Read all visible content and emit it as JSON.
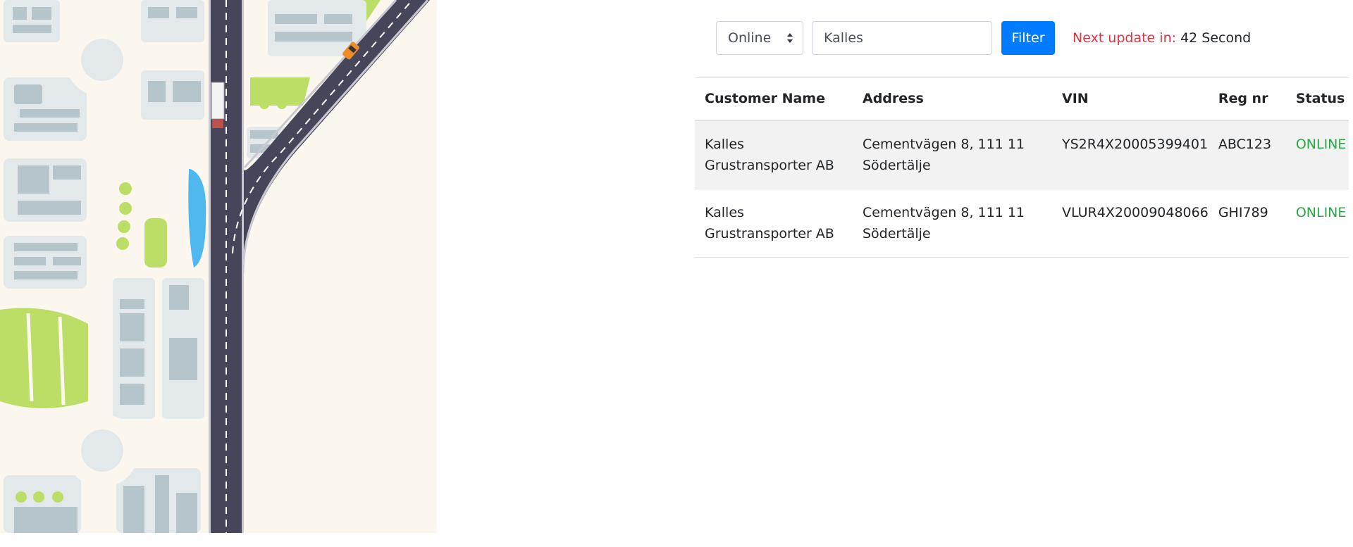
{
  "filters": {
    "status_selected": "Online",
    "search_value": "Kalles",
    "filter_button_label": "Filter",
    "next_update_label": "Next update in:",
    "next_update_value": "42 Second"
  },
  "table": {
    "headers": {
      "customer_name": "Customer Name",
      "address": "Address",
      "vin": "VIN",
      "reg_nr": "Reg nr",
      "status": "Status"
    },
    "rows": [
      {
        "customer_line1": "Kalles",
        "customer_line2": "Grustransporter AB",
        "address_line1": "Cementvägen 8, 111 11",
        "address_line2": "Södertälje",
        "vin": "YS2R4X20005399401",
        "reg_nr": "ABC123",
        "status": "ONLINE"
      },
      {
        "customer_line1": "Kalles",
        "customer_line2": "Grustransporter AB",
        "address_line1": "Cementvägen 8, 111 11",
        "address_line2": "Södertälje",
        "vin": "VLUR4X20009048066",
        "reg_nr": "GHI789",
        "status": "ONLINE"
      }
    ]
  },
  "colors": {
    "accent": "#007bff",
    "status_online": "#28a745",
    "update_label": "#dc3545"
  },
  "icons": [
    "select-caret-icon",
    "city-map-illustration",
    "truck-icon",
    "taxi-icon"
  ]
}
